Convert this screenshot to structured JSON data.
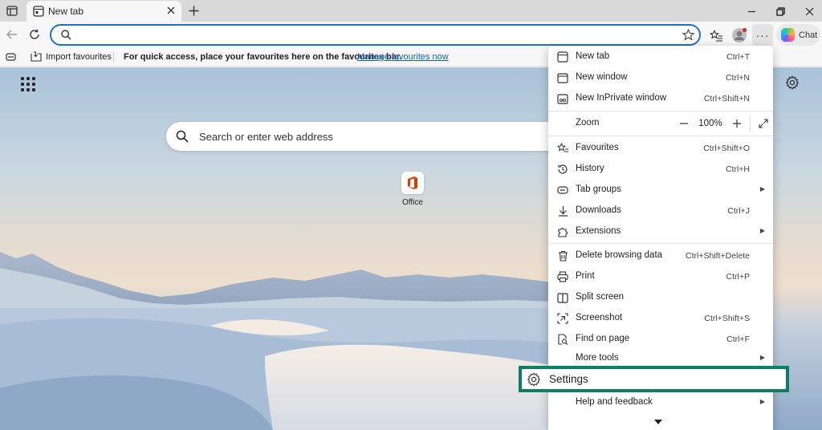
{
  "tab": {
    "title": "New tab"
  },
  "toolbar": {
    "address_placeholder": "",
    "chat_label": "Chat"
  },
  "favbar": {
    "import_label": "Import favourites",
    "message": "For quick access, place your favourites here on the favourites bar.",
    "manage_link": "Manage favourites now"
  },
  "newtab_page": {
    "search_placeholder": "Search or enter web address",
    "tiles": [
      {
        "label": "Office"
      }
    ]
  },
  "menu": {
    "items": [
      {
        "label": "New tab",
        "shortcut": "Ctrl+T",
        "icon": "new-tab-icon"
      },
      {
        "label": "New window",
        "shortcut": "Ctrl+N",
        "icon": "new-window-icon"
      },
      {
        "label": "New InPrivate window",
        "shortcut": "Ctrl+Shift+N",
        "icon": "inprivate-icon"
      },
      {
        "label": "Zoom",
        "zoom_value": "100%",
        "icon": ""
      },
      {
        "label": "Favourites",
        "shortcut": "Ctrl+Shift+O",
        "icon": "favourites-icon"
      },
      {
        "label": "History",
        "shortcut": "Ctrl+H",
        "icon": "history-icon"
      },
      {
        "label": "Tab groups",
        "shortcut": "",
        "icon": "tab-groups-icon"
      },
      {
        "label": "Downloads",
        "shortcut": "Ctrl+J",
        "icon": "download-icon"
      },
      {
        "label": "Extensions",
        "shortcut": "",
        "icon": "extensions-icon"
      },
      {
        "label": "Delete browsing data",
        "shortcut": "Ctrl+Shift+Delete",
        "icon": "trash-icon"
      },
      {
        "label": "Print",
        "shortcut": "Ctrl+P",
        "icon": "print-icon"
      },
      {
        "label": "Split screen",
        "shortcut": "",
        "icon": "split-screen-icon"
      },
      {
        "label": "Screenshot",
        "shortcut": "Ctrl+Shift+S",
        "icon": "screenshot-icon"
      },
      {
        "label": "Find on page",
        "shortcut": "Ctrl+F",
        "icon": "find-icon"
      },
      {
        "label": "More tools",
        "shortcut": "",
        "icon": ""
      },
      {
        "label": "Settings",
        "shortcut": "",
        "icon": "settings-icon"
      },
      {
        "label": "Help and feedback",
        "shortcut": "",
        "icon": ""
      }
    ]
  },
  "colors": {
    "accent": "#1a73c8",
    "highlight_border": "#0e7e63",
    "link": "#0b63c5"
  }
}
